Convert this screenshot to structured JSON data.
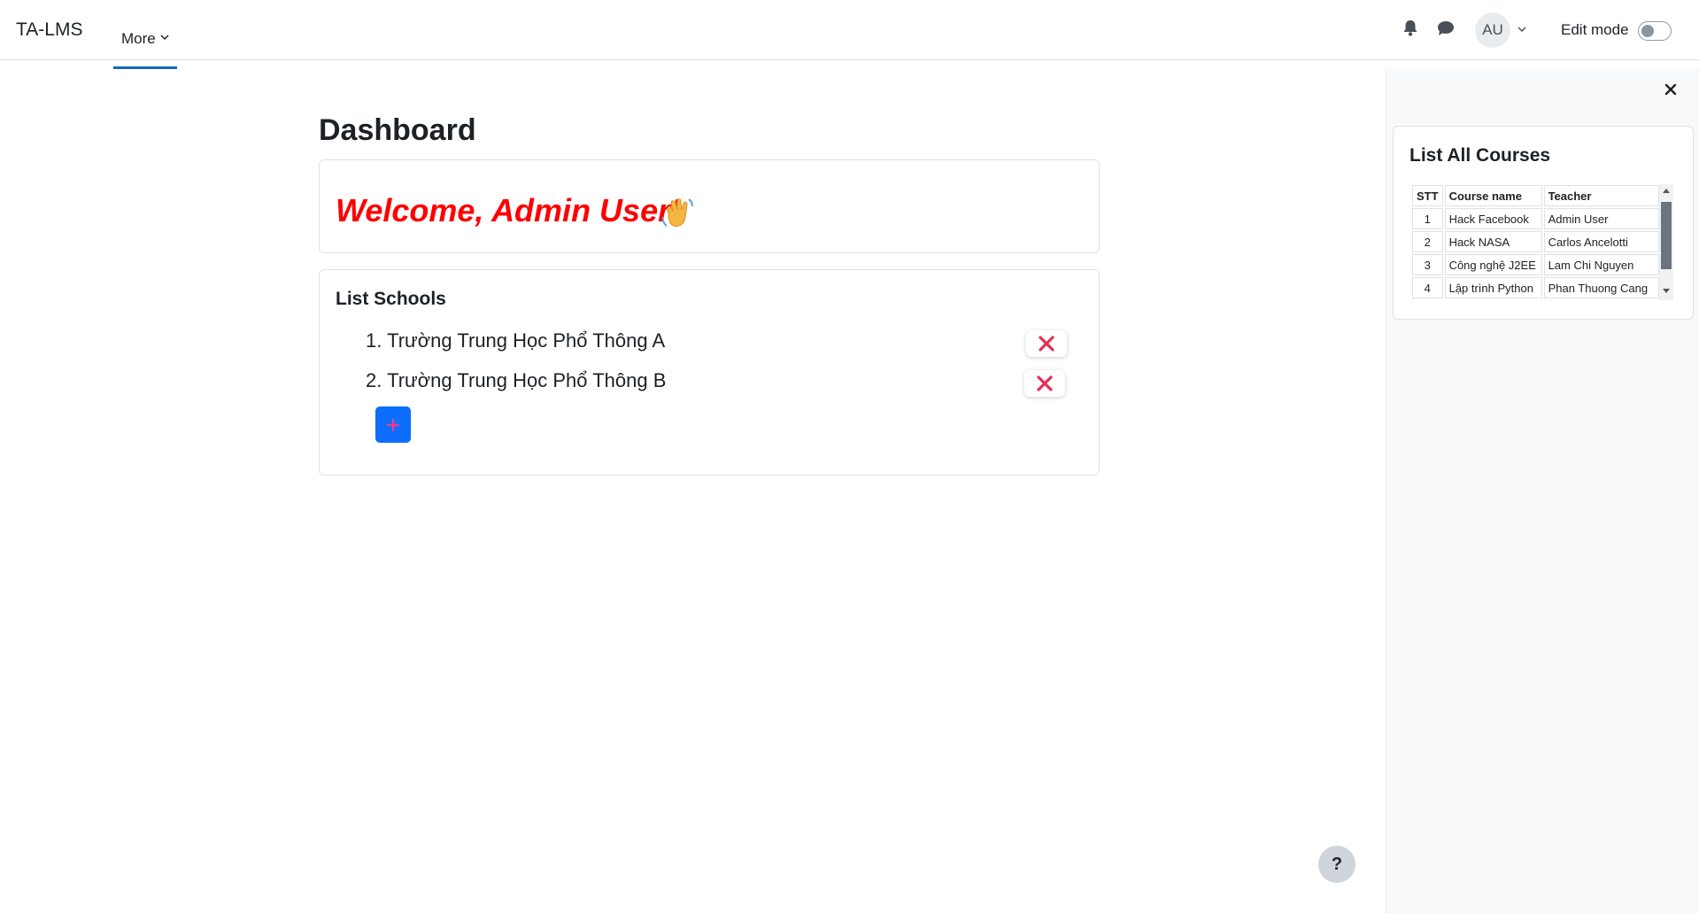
{
  "navbar": {
    "brand": "TA-LMS",
    "more_label": "More",
    "avatar_initials": "AU",
    "edit_mode_label": "Edit mode",
    "edit_mode_on": false,
    "icons": {
      "notifications": "bell-icon",
      "messages": "chat-icon",
      "user_menu": "chevron-down-icon"
    }
  },
  "main": {
    "title": "Dashboard",
    "welcome": {
      "text": "Welcome, Admin User!",
      "emoji": "waving-hand"
    },
    "schools": {
      "title": "List Schools",
      "items": [
        {
          "number": "1.",
          "name": "Trường Trung Học Phổ Thông A"
        },
        {
          "number": "2.",
          "name": "Trường Trung Học Phổ Thông B"
        }
      ]
    }
  },
  "drawer": {
    "block_title": "List All Courses",
    "columns": [
      "STT",
      "Course name",
      "Teacher"
    ],
    "rows": [
      [
        "1",
        "Hack Facebook",
        "Admin User"
      ],
      [
        "2",
        "Hack NASA",
        "Carlos Ancelotti"
      ],
      [
        "3",
        "Công nghệ J2EE",
        "Lam Chi Nguyen"
      ],
      [
        "4",
        "Lập trình Python",
        "Phan Thuong Cang"
      ]
    ]
  },
  "help": {
    "label": "?"
  },
  "colors": {
    "accent": "#0f6cbf",
    "welcome_text": "#ff0000",
    "delete_icon": "#e62e55",
    "add_button": "#0d6efd",
    "add_icon": "#e83e8c"
  }
}
